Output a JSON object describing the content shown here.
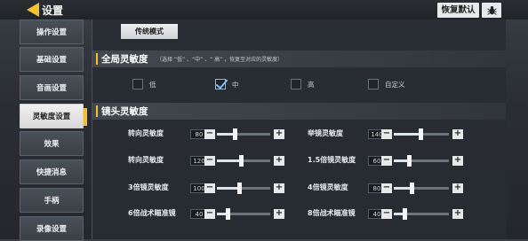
{
  "header": {
    "title": "设置",
    "reset_label": "恢复默认"
  },
  "sidebar": {
    "items": [
      {
        "label": "操作设置",
        "active": false
      },
      {
        "label": "基础设置",
        "active": false
      },
      {
        "label": "音画设置",
        "active": false
      },
      {
        "label": "灵敏度设置",
        "active": true
      },
      {
        "label": "效果",
        "active": false
      },
      {
        "label": "快捷消息",
        "active": false
      },
      {
        "label": "手柄",
        "active": false
      },
      {
        "label": "录像设置",
        "active": false
      }
    ]
  },
  "tab": {
    "label": "传统模式"
  },
  "overall": {
    "title": "全局灵敏度",
    "hint": "（选择 “低” 、“中” 、“ 高” ，恢复至对应的灵敏度）",
    "options": [
      {
        "label": "低",
        "checked": false
      },
      {
        "label": "中",
        "checked": true
      },
      {
        "label": "高",
        "checked": false
      },
      {
        "label": "自定义",
        "checked": false
      }
    ]
  },
  "camera": {
    "title": "镜头灵敏度",
    "sliders": [
      {
        "label": "转向灵敏度",
        "value": "80",
        "level": 0.33
      },
      {
        "label": "举镜灵敏度",
        "value": "140",
        "level": 0.48
      },
      {
        "label": "转向灵敏度",
        "value": "120",
        "level": 0.45
      },
      {
        "label": "1.5倍镜灵敏度",
        "value": "60",
        "level": 0.28
      },
      {
        "label": "3倍镜灵敏度",
        "value": "100",
        "level": 0.42
      },
      {
        "label": "4倍镜灵敏度",
        "value": "80",
        "level": 0.33
      },
      {
        "label": "6倍战术瞄准镜",
        "value": "40",
        "level": 0.2
      },
      {
        "label": "8倍战术瞄准镜",
        "value": "40",
        "level": 0.2
      }
    ]
  },
  "colors": {
    "accent": "#f2c230",
    "check": "#7ec0ff"
  }
}
